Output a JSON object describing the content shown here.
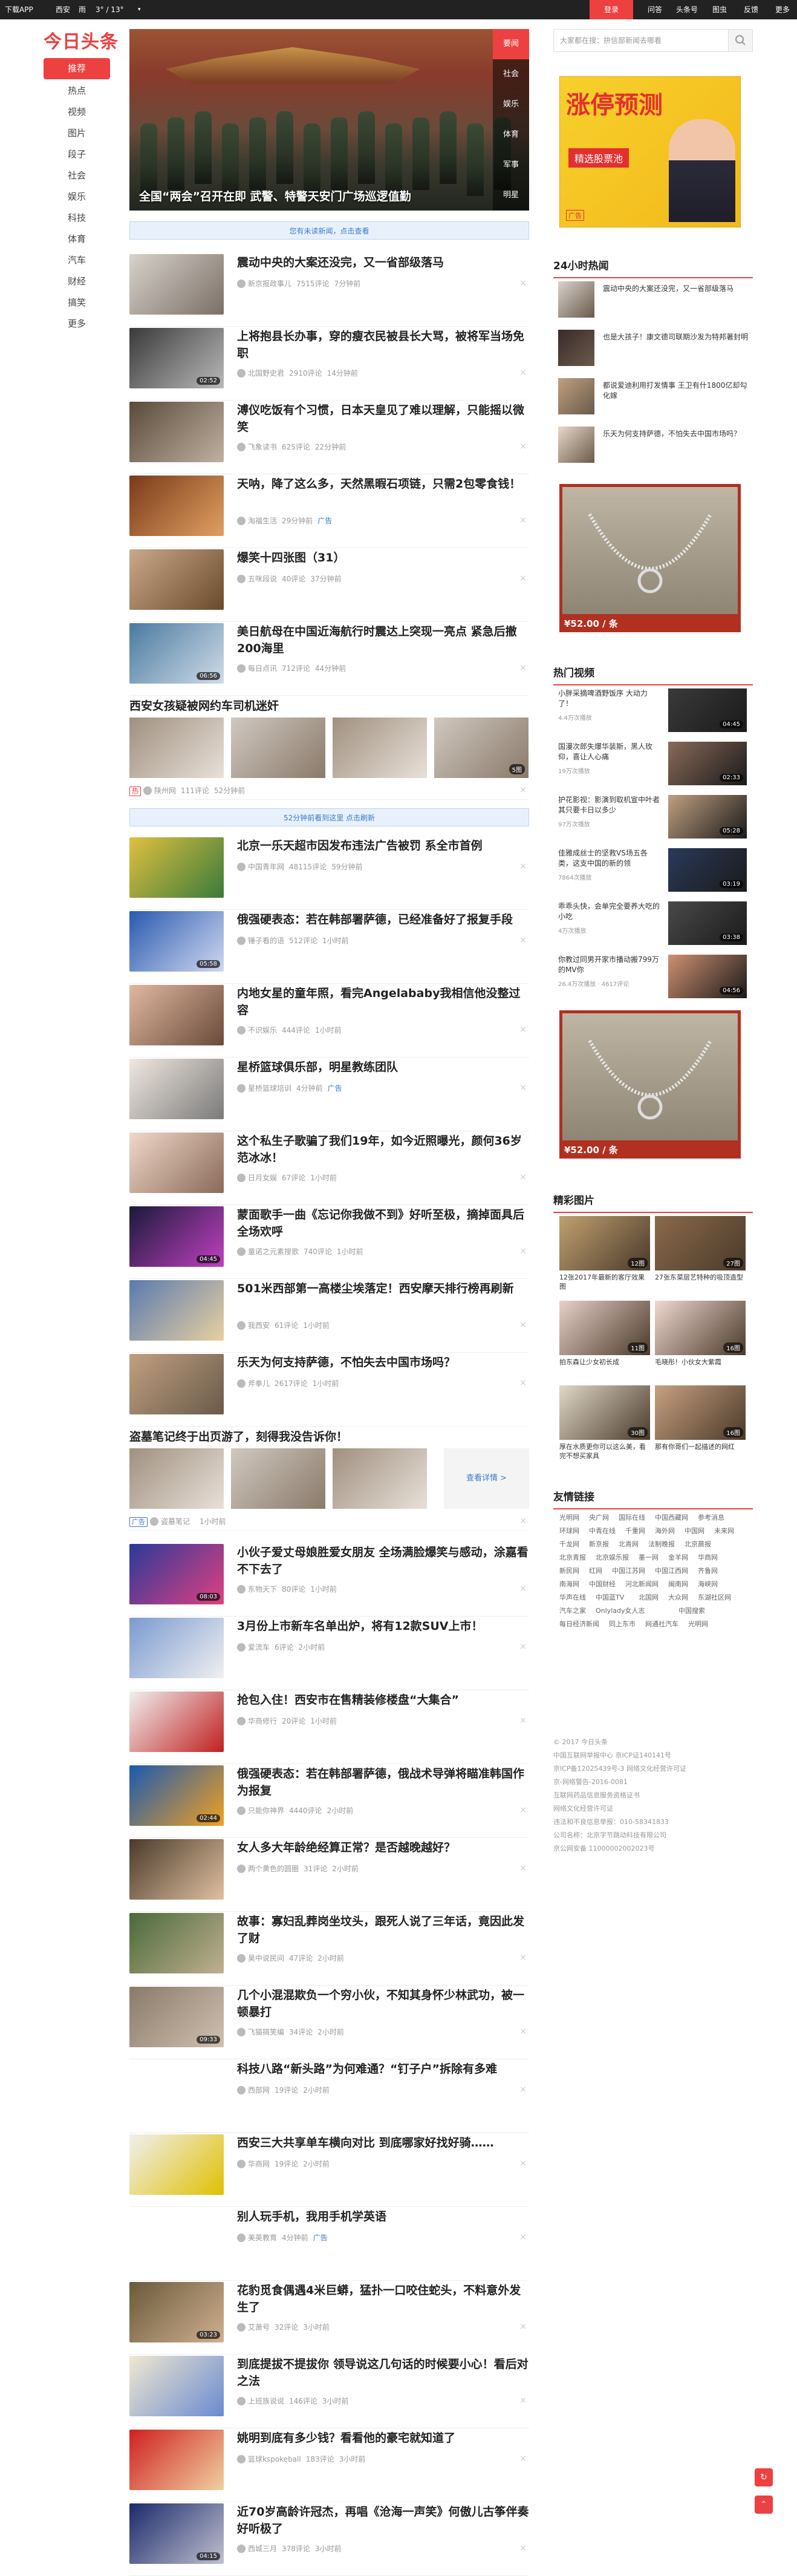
{
  "topbar": {
    "download_app": "下载APP",
    "location": "西安",
    "weather_state": "雨",
    "temperature": "3° / 13°",
    "login_label": "登录",
    "menu": [
      "问答",
      "头条号",
      "图虫",
      "反馈",
      "投诉",
      "更多"
    ]
  },
  "logo": "今日头条",
  "nav": [
    "推荐",
    "热点",
    "视频",
    "图片",
    "段子",
    "社会",
    "娱乐",
    "科技",
    "体育",
    "汽车",
    "财经",
    "搞笑",
    "更多"
  ],
  "hero": {
    "caption": "全国“两会”召开在即 武警、特警天安门广场巡逻值勤",
    "tabs": [
      "要闻",
      "社会",
      "娱乐",
      "体育",
      "军事",
      "明星"
    ]
  },
  "refresh_top": "您有未读新闻，点击查看",
  "refresh_mid": "52分钟前看到这里 点击刷新",
  "feed": [
    {
      "title": "震动中央的大案还没完，又一省部级落马",
      "source": "新京报政事儿",
      "comments": "7515评论",
      "time": "7分钟前",
      "tag": ""
    },
    {
      "title": "上将抱县长办事，穿的瘦衣民被县长大骂，被将军当场免职",
      "source": "北国野史君",
      "comments": "2910评论",
      "time": "14分钟前",
      "tag": "",
      "duration": "02:52"
    },
    {
      "title": "溥仪吃饭有个习惯，日本天皇见了难以理解，只能摇以微笑",
      "source": "飞象读书",
      "comments": "625评论",
      "time": "22分钟前",
      "tag": ""
    },
    {
      "title": "天呐，降了这么多，天然黑暇石项链，只需2包零食钱！",
      "source": "淘福生活",
      "comments": "",
      "time": "29分钟前",
      "tag": "广告"
    },
    {
      "title": "爆笑十四张图（31）",
      "source": "五咪段说",
      "comments": "40评论",
      "time": "37分钟前",
      "tag": ""
    },
    {
      "title": "美日航母在中国近海航行时震达上突现一亮点 紧急后撤200海里",
      "source": "每日点讯",
      "comments": "712评论",
      "time": "44分钟前",
      "tag": "",
      "duration": "06:56"
    },
    {
      "title": "西安女孩疑被网约车司机迷奸",
      "source": "陕州网",
      "comments": "111评论",
      "time": "52分钟前",
      "tag": "热",
      "image_count": "5图"
    },
    {
      "title": "北京一乐天超市因发布违法广告被罚 系全市首例",
      "source": "中国青年网",
      "comments": "48115评论",
      "time": "59分钟前",
      "tag": ""
    },
    {
      "title": "俄强硬表态：若在韩部署萨德，已经准备好了报复手段",
      "source": "锤子看的语",
      "comments": "512评论",
      "time": "1小时前",
      "tag": "",
      "duration": "05:58"
    },
    {
      "title": "内地女星的童年照，看完Angelababy我相信他没整过容",
      "source": "不识娱乐",
      "comments": "444评论",
      "time": "1小时前",
      "tag": ""
    },
    {
      "title": "星桥篮球俱乐部，明星教练团队",
      "source": "星桥篮球培训",
      "comments": "",
      "time": "4分钟前",
      "tag": "广告"
    },
    {
      "title": "这个私生子歌骗了我们19年，如今近照曝光，颜何36岁范冰冰！",
      "source": "日月女娱",
      "comments": "67评论",
      "time": "1小时前",
      "tag": ""
    },
    {
      "title": "蒙面歌手一曲《忘记你我做不到》好听至极，摘掉面具后全场欢呼",
      "source": "童诺之元素搜歌",
      "comments": "740评论",
      "time": "1小时前",
      "tag": "",
      "duration": "04:45"
    },
    {
      "title": "501米西部第一高楼尘埃落定！西安摩天排行榜再刷新",
      "source": "我西安",
      "comments": "61评论",
      "time": "1小时前",
      "tag": ""
    },
    {
      "title": "乐天为何支持萨德，不怕失去中国市场吗？",
      "source": "斧拳儿",
      "comments": "2617评论",
      "time": "1小时前",
      "tag": ""
    },
    {
      "title": "盗墓笔记终于出页游了，刻得我没告诉你！",
      "source": "盗墓笔记",
      "comments": "",
      "time": "1小时前",
      "tag": "广告",
      "cta": "查看详情 >"
    },
    {
      "title": "小伙子爱丈母娘胜爱女朋友 全场满脸爆笑与感动，涂嘉看不下去了",
      "source": "东物天下",
      "comments": "80评论",
      "time": "1小时前",
      "tag": "",
      "duration": "08:03"
    },
    {
      "title": "3月份上市新车名单出炉，将有12款SUV上市！",
      "source": "爱流车",
      "comments": "6评论",
      "time": "2小时前",
      "tag": ""
    },
    {
      "title": "抢包入住！西安市在售精装修楼盘“大集合”",
      "source": "华商修行",
      "comments": "20评论",
      "time": "1小时前",
      "tag": ""
    },
    {
      "title": "俄强硬表态：若在韩部署萨德，俄战术导弹将瞄准韩国作为报复",
      "source": "只能你神界",
      "comments": "4440评论",
      "time": "2小时前",
      "tag": "",
      "duration": "02:44"
    },
    {
      "title": "女人多大年龄绝经算正常？是否越晚越好？",
      "source": "两个黄色的圆圈",
      "comments": "31评论",
      "time": "2小时前",
      "tag": ""
    },
    {
      "title": "故事：寡妇乱葬岗坐坟头，跟死人说了三年话，竟因此发了财",
      "source": "昊中说民间",
      "comments": "47评论",
      "time": "2小时前",
      "tag": ""
    },
    {
      "title": "几个小混混欺负一个穷小伙，不知其身怀少林武功，被一顿暴打",
      "source": "飞猫搞笑编",
      "comments": "34评论",
      "time": "2小时前",
      "tag": "",
      "duration": "09:33"
    },
    {
      "title": "科技八路“新头路”为何难通？“钉子户”拆除有多难",
      "source": "西部网",
      "comments": "19评论",
      "time": "2小时前",
      "tag": ""
    },
    {
      "title": "西安三大共享单车横向对比 到底哪家好找好骑……",
      "source": "华商网",
      "comments": "19评论",
      "time": "2小时前",
      "tag": ""
    },
    {
      "title": "别人玩手机，我用手机学英语",
      "source": "美英教育",
      "comments": "",
      "time": "4分钟前",
      "tag": "广告"
    },
    {
      "title": "花豹觅食偶遇4米巨蟒，猛扑一口咬住蛇头，不料意外发生了",
      "source": "艾萧号",
      "comments": "32评论",
      "time": "3小时前",
      "tag": "",
      "duration": "03:23"
    },
    {
      "title": "到底提拔不提拔你 领导说这几句话的时候要小心！看后对之法",
      "source": "上班族说说",
      "comments": "146评论",
      "time": "3小时前",
      "tag": ""
    },
    {
      "title": "姚明到底有多少钱？看看他的豪宅就知道了",
      "source": "篮球kspokeball",
      "comments": "183评论",
      "time": "3小时前",
      "tag": ""
    },
    {
      "title": "近70岁高龄许冠杰，再唱《沧海一声笑》何傲儿古筝伴奏好听极了",
      "source": "西城三月",
      "comments": "378评论",
      "time": "3小时前",
      "tag": "",
      "duration": "04:15"
    }
  ],
  "right": {
    "search_placeholder": "大家都在搜：拚信部新闻去哪看",
    "ad_banner": {
      "title": "涨停预测",
      "subtitle": "精选股票池",
      "badge": "广告"
    },
    "hot24_title": "24小时热闻",
    "hot24": [
      "震动中央的大案还没完，又一省部级落马",
      "也是大孩子！康文德司联期沙发为特邦著封明",
      "都说爱迪利用打发情事 王卫有什1800亿却勾化嫁",
      "乐天为何支持萨德，不怕失去中国市场吗？"
    ],
    "ad_price": "¥52.00 / 条",
    "hot_video_title": "热门视频",
    "hot_videos": [
      {
        "title": "小胖采摘啤酒野饭序 大动力了！",
        "meta": "4.4万次播放",
        "duration": "04:45"
      },
      {
        "title": "国漫次郎失爆华装斯，黑人玫仰，喜让人心痛",
        "meta": "19万次播放",
        "duration": "02:33"
      },
      {
        "title": "护花影视：影演到取机宣中叶者其只要卡日以多少",
        "meta": "97万次播放",
        "duration": "05:28"
      },
      {
        "title": "佳雅成丝士的坚救VS场五各类，这支中国的新的领",
        "meta": "7864次播放",
        "duration": "03:19"
      },
      {
        "title": "乖乖头快，会单完全要养大吃的小吃",
        "meta": "4万次播放",
        "duration": "03:38"
      },
      {
        "title": "你教过同男开家市播动搬799万的MV你",
        "meta": "26.4万次播放 · 4617评论",
        "duration": "04:56"
      }
    ],
    "pic_title": "精彩图片",
    "pics": [
      {
        "caption": "12张2017年最新的客厅效果图",
        "count": "12图"
      },
      {
        "caption": "27张东菜层艺特种的吸顶造型",
        "count": "27图"
      },
      {
        "caption": "拍东森让少女初长成",
        "count": "11图"
      },
      {
        "caption": "毛晓彤！小伙女大紫霞",
        "count": "16图"
      },
      {
        "caption": "厚在水质更你可以这么美，看完不想买家具",
        "count": "30图"
      },
      {
        "caption": "那有你哥们一起描述的网红",
        "count": "16图"
      }
    ],
    "friends_title": "友情链接",
    "links": [
      "光明网",
      "央广网",
      "国际在线",
      "中国西藏网",
      "参考消息",
      "环球网",
      "中青在线",
      "千重网",
      "海外网",
      "中国网",
      "未来网",
      "千龙网",
      "新京报",
      "北青网",
      "法制晚报",
      "北京晨报",
      "北京青报",
      "北京娱乐报",
      "墨一网",
      "金羊网",
      "华商网",
      "新民网",
      "红网",
      "中国江苏网",
      "中国江西网",
      "齐鲁网",
      "南海网",
      "中国财经",
      "河北新闻网",
      "闽南网",
      "海峡网",
      "华声在线",
      "中国蓝TV",
      "北国网",
      "大众网",
      "东湖社区网",
      "汽车之家",
      "Onlylady女人志",
      "中国搜索",
      "每日经济新闻",
      "同上东市",
      "网通社汽车",
      "光明网"
    ],
    "footer": [
      "© 2017 今日头条",
      "中国互联网举报中心 京ICP证140141号",
      "京ICP备12025439号-3 网络文化经营许可证",
      "京-网络警告-2016-0081",
      "互联网药品信息服务资格证书",
      "网络文化经营许可证",
      "违法和不良信息举报：010-58341833",
      "公司名称：北京字节跳动科技有限公司",
      "京公网安备 11000002002023号"
    ]
  },
  "colors": {
    "accent": "#ed4040",
    "link_blue": "#3a7ac8",
    "topbar": "#222222"
  }
}
